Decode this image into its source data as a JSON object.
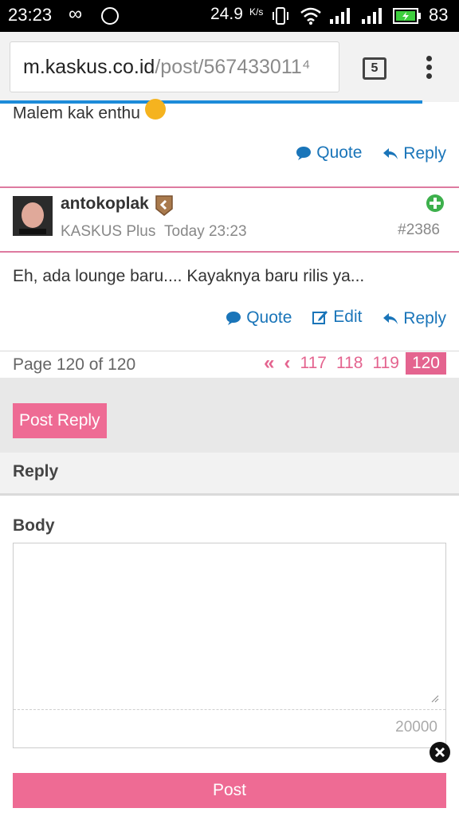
{
  "status_bar": {
    "time": "23:23",
    "speed": "24.9",
    "speed_unit": "K/s",
    "battery": "83"
  },
  "browser": {
    "url_host": "m.kaskus.co.id",
    "url_path": "/post/567433011⁴",
    "tab_count": "5"
  },
  "post_prev": {
    "text": "Malem kak enthu",
    "actions": {
      "quote": "Quote",
      "reply": "Reply"
    }
  },
  "post": {
    "username": "antokoplak",
    "avatar_caption": "antokoplak",
    "user_title": "KASKUS Plus",
    "time": "Today 23:23",
    "number": "#2386",
    "text": "Eh, ada lounge baru.... Kayaknya baru rilis ya...",
    "actions": {
      "quote": "Quote",
      "edit": "Edit",
      "reply": "Reply"
    }
  },
  "pagination": {
    "info": "Page 120 of 120",
    "first": "«",
    "prev": "‹",
    "pages": [
      "117",
      "118",
      "119"
    ],
    "current": "120"
  },
  "reply_form": {
    "post_reply_button": "Post Reply",
    "section_title": "Reply",
    "body_label": "Body",
    "char_limit": "20000",
    "submit": "Post"
  },
  "colors": {
    "accent_pink": "#ee6b94",
    "link_blue": "#1a75b9"
  }
}
